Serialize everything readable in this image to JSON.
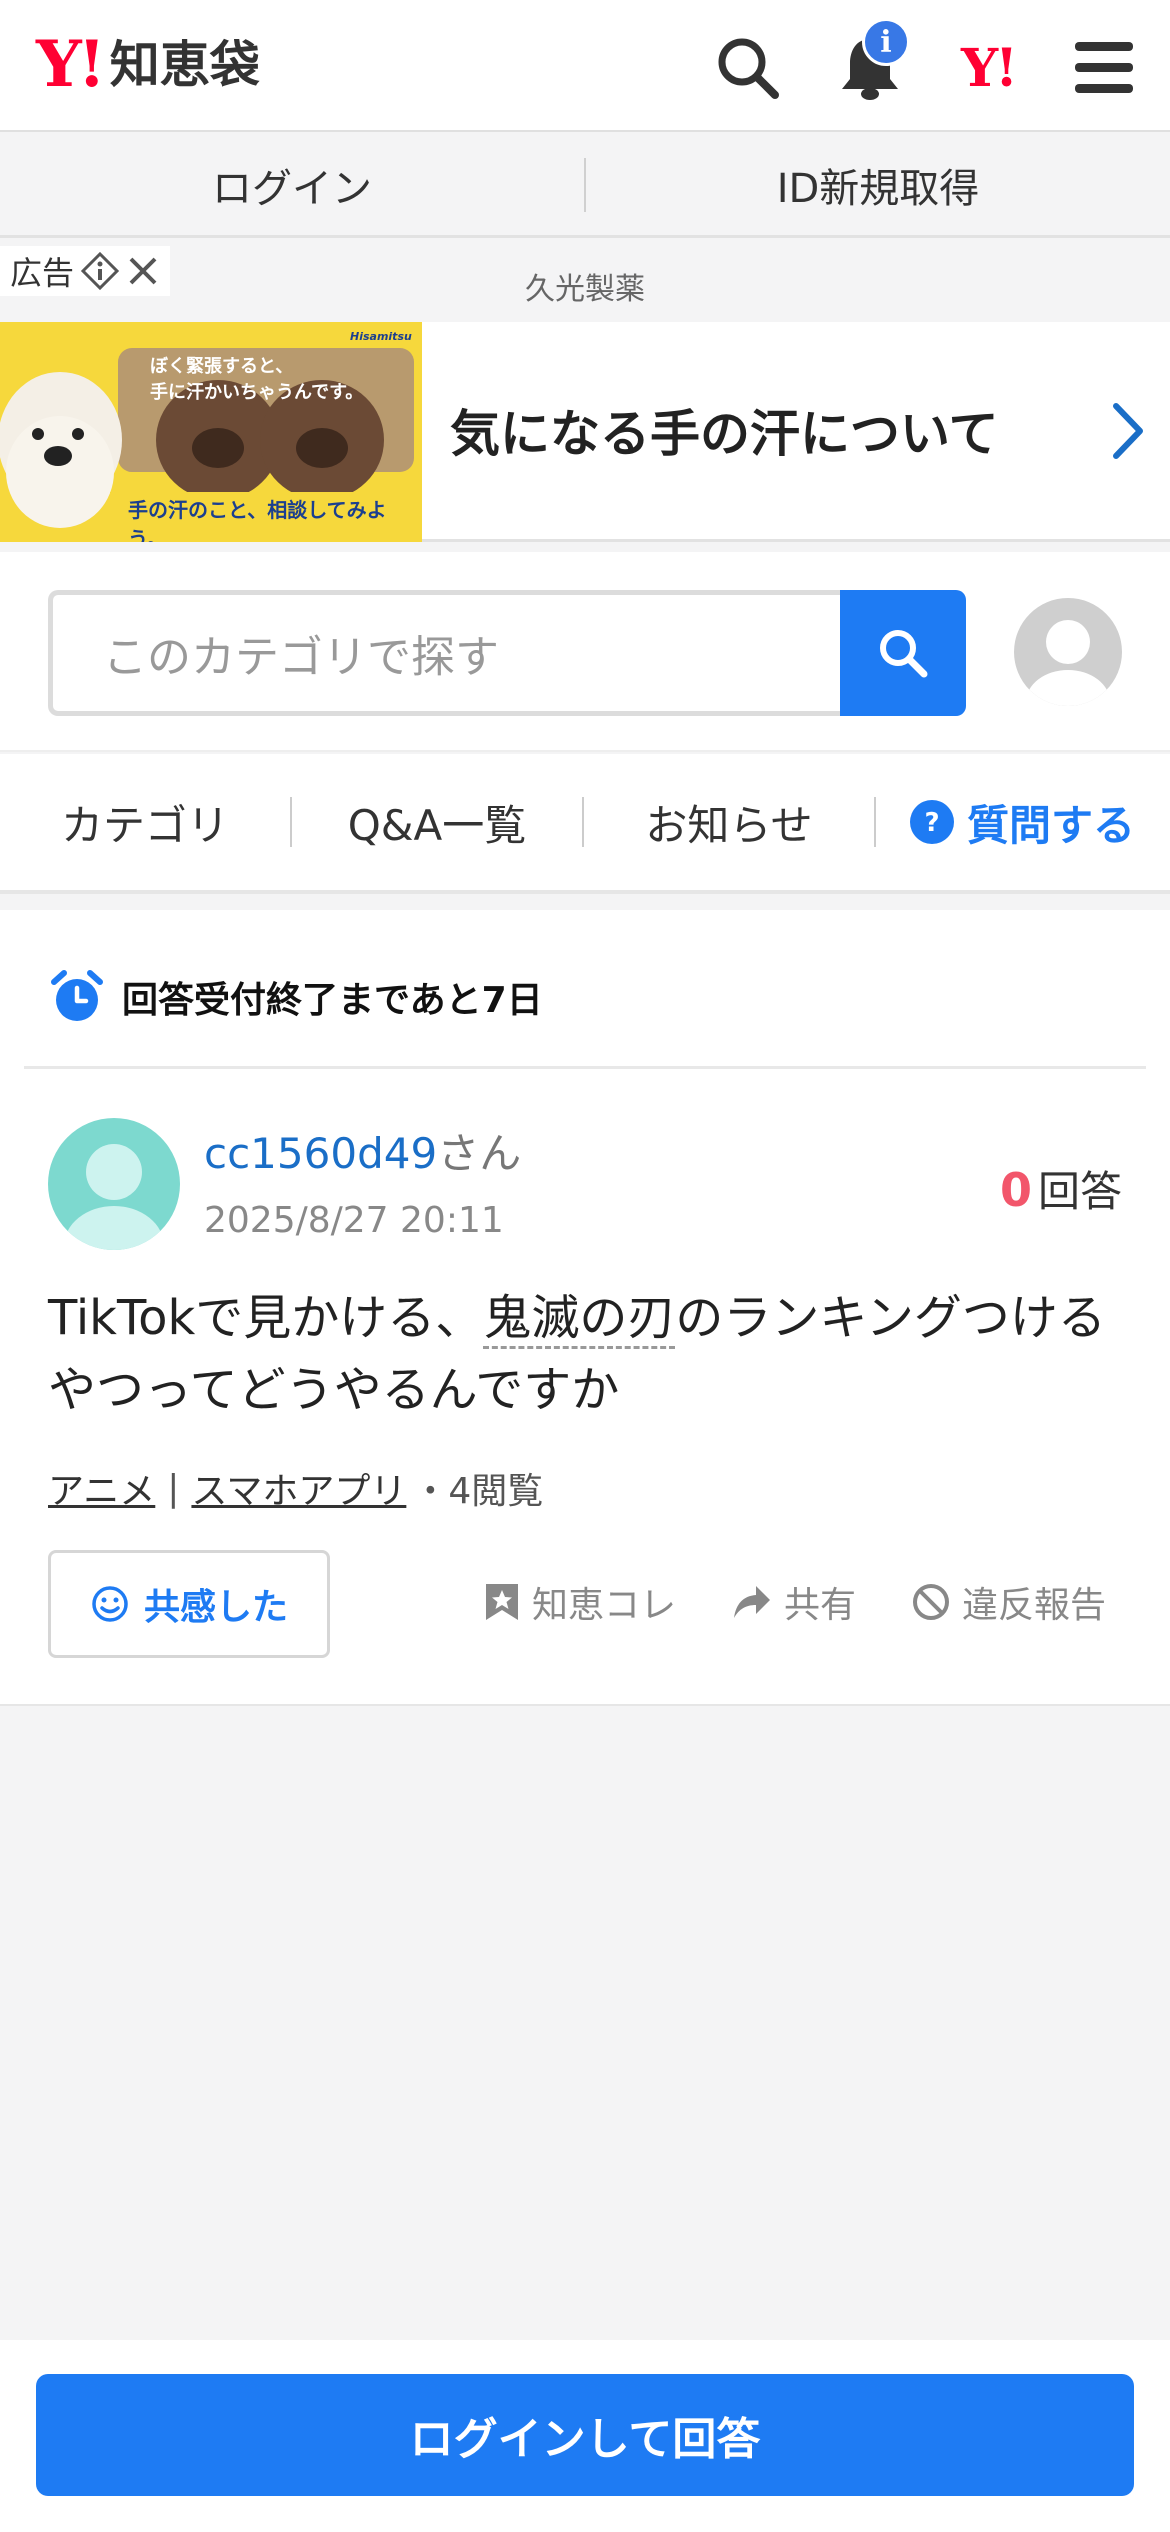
{
  "header": {
    "logo_y": "Y!",
    "logo_text": "知恵袋",
    "notification_badge": "i",
    "yahoo_mark": "Y!"
  },
  "login_bar": {
    "login_label": "ログイン",
    "register_label": "ID新規取得"
  },
  "ad": {
    "label": "広告",
    "sponsor": "久光製薬",
    "image_line1": "ぼく緊張すると、",
    "image_line2": "手に汗かいちゃうんです。",
    "image_caption": "手の汗のこと、相談してみよう。",
    "image_brand": "Hisamitsu",
    "title": "気になる手の汗について"
  },
  "search": {
    "placeholder": "このカテゴリで探す"
  },
  "nav": {
    "items": [
      "カテゴリ",
      "Q&A一覧",
      "お知らせ"
    ],
    "ask_label": "質問する"
  },
  "question": {
    "deadline": "回答受付終了まであと7日",
    "user": "cc1560d49",
    "user_suffix": "さん",
    "date": "2025/8/27 20:11",
    "answer_count": "0",
    "answer_label": "回答",
    "body_before": "TikTokで見かける、",
    "body_keyword": "鬼滅の刃",
    "body_after": "のランキングつけるやつってどうやるんですか",
    "tags": [
      "アニメ",
      "スマホアプリ"
    ],
    "tag_separator": "|",
    "views": "・4閲覧",
    "empathy_label": "共感した",
    "actions": {
      "collect": "知恵コレ",
      "share": "共有",
      "report": "違反報告"
    }
  },
  "bottom": {
    "answer_button": "ログインして回答"
  },
  "colors": {
    "brand_red": "#ff0033",
    "accent_blue": "#1e7bf3",
    "link_blue": "#1a6ec7",
    "answer_count_red": "#f2566b"
  }
}
